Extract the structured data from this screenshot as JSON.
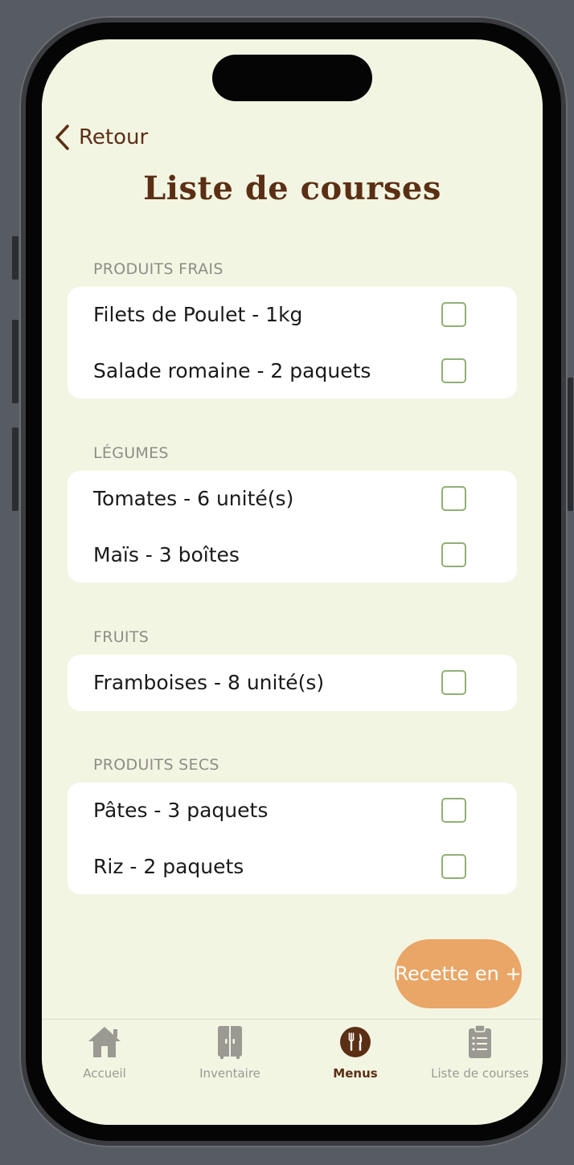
{
  "nav": {
    "back_label": "Retour"
  },
  "page": {
    "title": "Liste de courses"
  },
  "sections": [
    {
      "header": "PRODUITS FRAIS",
      "items": [
        {
          "label": "Filets de Poulet - 1kg",
          "checked": false
        },
        {
          "label": "Salade romaine - 2 paquets",
          "checked": false
        }
      ]
    },
    {
      "header": "LÉGUMES",
      "items": [
        {
          "label": "Tomates - 6 unité(s)",
          "checked": false
        },
        {
          "label": "Maïs - 3 boîtes",
          "checked": false
        }
      ]
    },
    {
      "header": "FRUITS",
      "items": [
        {
          "label": "Framboises - 8 unité(s)",
          "checked": false
        }
      ]
    },
    {
      "header": "PRODUITS SECS",
      "items": [
        {
          "label": "Pâtes - 3 paquets",
          "checked": false
        },
        {
          "label": "Riz - 2 paquets",
          "checked": false
        }
      ]
    }
  ],
  "fab": {
    "label": "Recette en +"
  },
  "tabs": [
    {
      "label": "Accueil",
      "icon": "house-icon",
      "active": false
    },
    {
      "label": "Inventaire",
      "icon": "fridge-icon",
      "active": false
    },
    {
      "label": "Menus",
      "icon": "fork-knife-icon",
      "active": true
    },
    {
      "label": "Liste de courses",
      "icon": "clipboard-list-icon",
      "active": false
    }
  ],
  "colors": {
    "background": "#f3f5e3",
    "brand_brown": "#5b2f14",
    "checkbox_green": "#8fb075",
    "fab_orange": "#e9a667",
    "inactive_gray": "#9a9a93"
  }
}
